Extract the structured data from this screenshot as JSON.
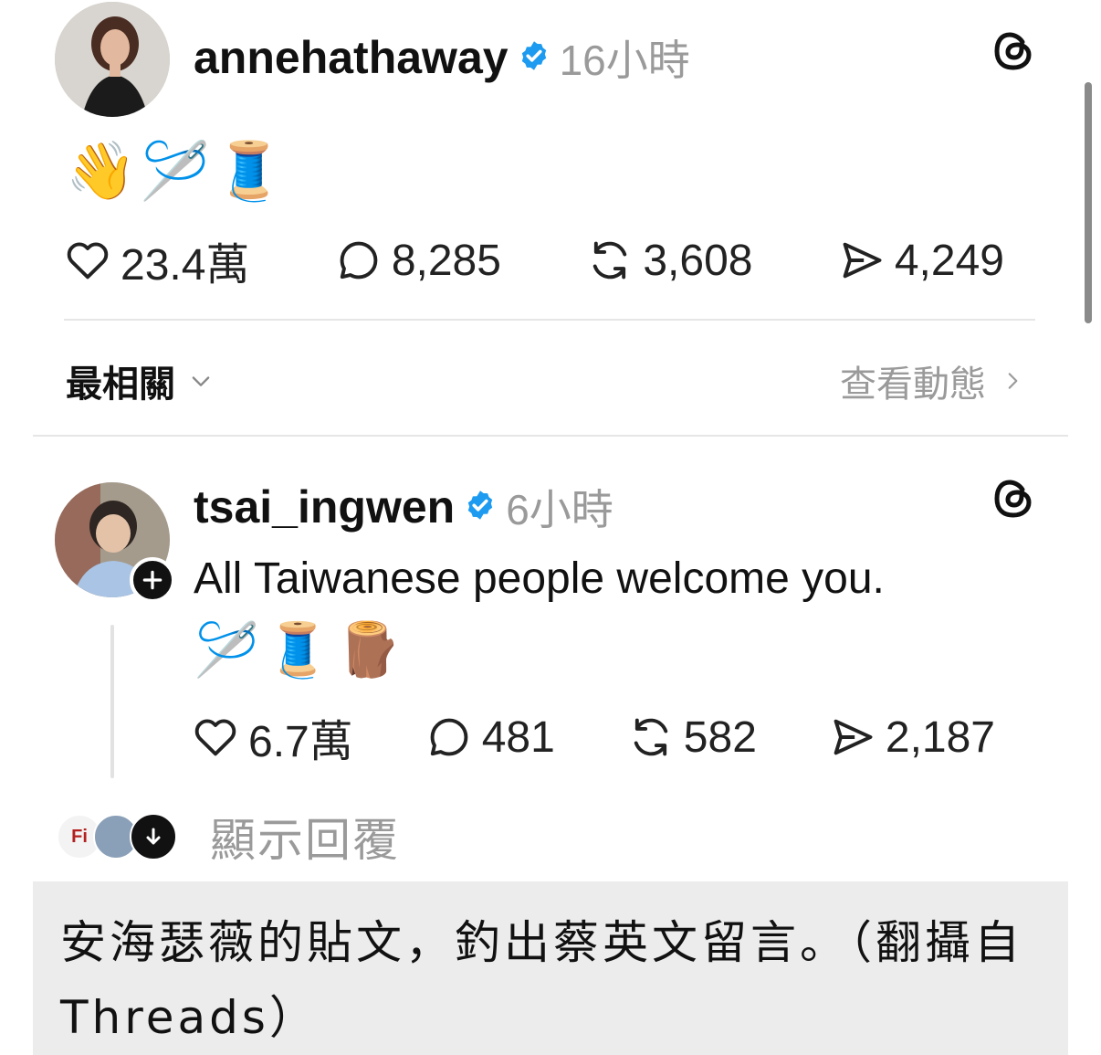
{
  "post1": {
    "username": "annehathaway",
    "time": "16小時",
    "emoji": "👋🪡🧵",
    "stats": {
      "likes": "23.4萬",
      "comments": "8,285",
      "reposts": "3,608",
      "shares": "4,249"
    }
  },
  "sort": {
    "label": "最相關",
    "activity": "查看動態"
  },
  "post2": {
    "username": "tsai_ingwen",
    "time": "6小時",
    "text": "All Taiwanese people welcome you.",
    "emoji": "🪡🧵🪵",
    "stats": {
      "likes": "6.7萬",
      "comments": "481",
      "reposts": "582",
      "shares": "2,187"
    }
  },
  "replies": {
    "label": "顯示回覆",
    "avatar_text": "Fi"
  },
  "caption": "安海瑟薇的貼文，釣出蔡英文留言。（翻攝自Threads）",
  "colors": {
    "verified": "#1d9bf0",
    "muted": "#9a9a9a",
    "caption_bg": "#ececec"
  }
}
